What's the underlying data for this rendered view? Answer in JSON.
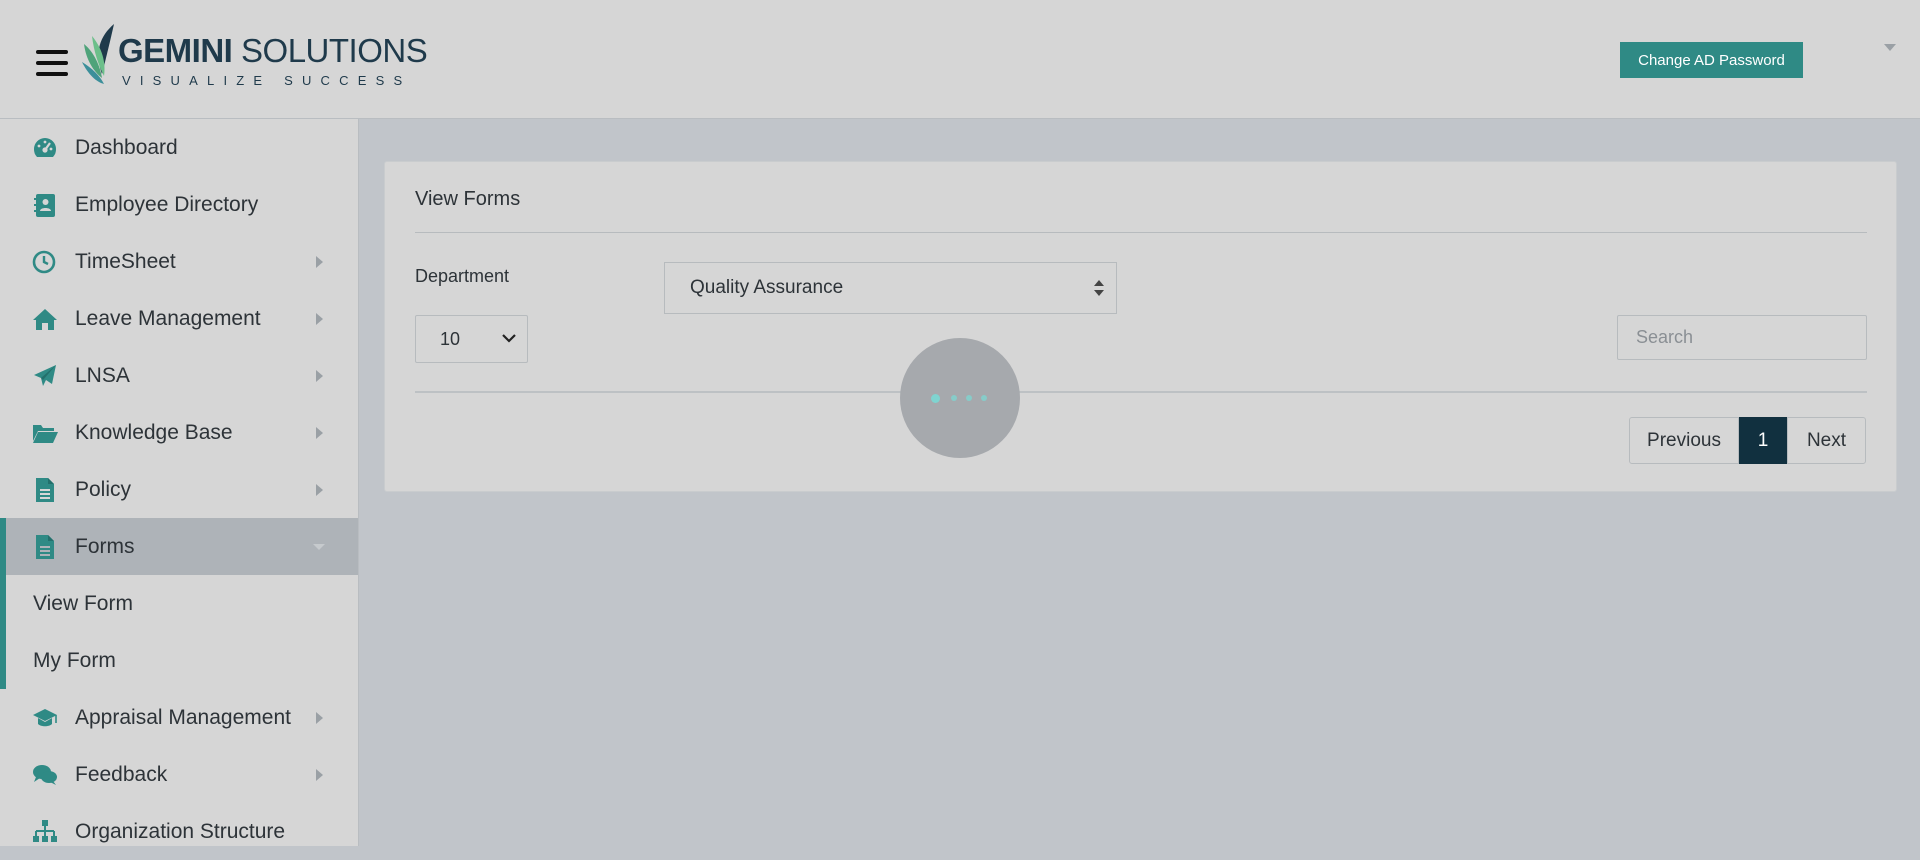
{
  "header": {
    "logo_brand": "GEMINI",
    "logo_brand2": "SOLUTIONS",
    "logo_tagline": "VISUALIZE SUCCESS",
    "change_password_label": "Change AD Password"
  },
  "sidebar": {
    "items": [
      {
        "label": "Dashboard",
        "icon": "dashboard-icon",
        "has_arrow": false
      },
      {
        "label": "Employee Directory",
        "icon": "contact-book-icon",
        "has_arrow": false
      },
      {
        "label": "TimeSheet",
        "icon": "clock-icon",
        "has_arrow": true
      },
      {
        "label": "Leave Management",
        "icon": "home-icon",
        "has_arrow": true
      },
      {
        "label": "LNSA",
        "icon": "paper-plane-icon",
        "has_arrow": true
      },
      {
        "label": "Knowledge Base",
        "icon": "folder-open-icon",
        "has_arrow": true
      },
      {
        "label": "Policy",
        "icon": "document-icon",
        "has_arrow": true
      },
      {
        "label": "Forms",
        "icon": "document-icon",
        "has_arrow": true,
        "active": true
      },
      {
        "label": "Appraisal Management",
        "icon": "graduation-cap-icon",
        "has_arrow": true
      },
      {
        "label": "Feedback",
        "icon": "comments-icon",
        "has_arrow": true
      },
      {
        "label": "Organization Structure",
        "icon": "sitemap-icon",
        "has_arrow": false
      }
    ],
    "forms_sub": [
      "View Form",
      "My Form"
    ]
  },
  "main": {
    "title": "View Forms",
    "department_label": "Department",
    "department_value": "Quality Assurance",
    "page_length_value": "10",
    "search_placeholder": "Search",
    "pagination": {
      "previous": "Previous",
      "current": "1",
      "next": "Next"
    }
  },
  "colors": {
    "accent": "#2f8a85",
    "pager_active": "#11303f",
    "loader_dot": "#7fd4d0"
  }
}
